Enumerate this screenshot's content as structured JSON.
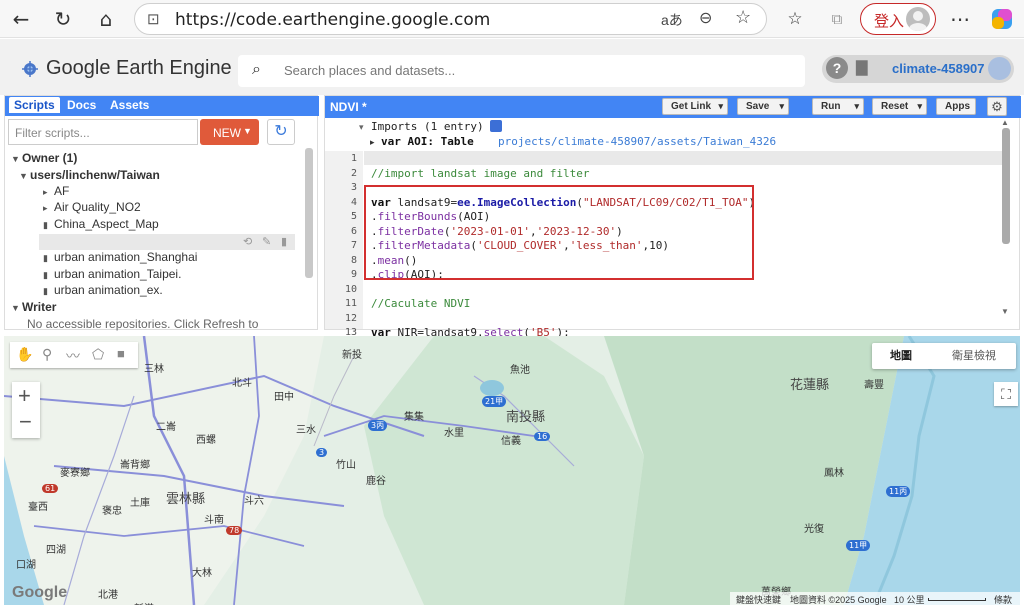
{
  "browser": {
    "url": "https://code.earthengine.google.com",
    "login_label": "登入"
  },
  "header": {
    "app_title": "Google Earth Engine",
    "search_placeholder": "Search places and datasets...",
    "project": "climate-458907"
  },
  "left_panel": {
    "tabs": [
      "Scripts",
      "Docs",
      "Assets"
    ],
    "filter_placeholder": "Filter scripts...",
    "new_label": "NEW",
    "tree": [
      {
        "label": "Owner (1)",
        "level": 0,
        "toggle": "▼",
        "bold": true
      },
      {
        "label": "users/linchenw/Taiwan",
        "level": 1,
        "toggle": "▼",
        "bold": true
      },
      {
        "label": "AF",
        "level": 2,
        "toggle": "▸",
        "bold": false
      },
      {
        "label": "Air Quality_NO2",
        "level": 2,
        "toggle": "▸",
        "bold": false
      },
      {
        "label": "China_Aspect_Map",
        "level": 2,
        "toggle": "",
        "bold": false
      },
      {
        "label": "NDVI",
        "level": 2,
        "toggle": "",
        "bold": false,
        "selected": true
      },
      {
        "label": "urban animation_Shanghai",
        "level": 2,
        "toggle": "",
        "bold": false
      },
      {
        "label": "urban animation_Taipei.",
        "level": 2,
        "toggle": "",
        "bold": false
      },
      {
        "label": "urban animation_ex.",
        "level": 2,
        "toggle": "",
        "bold": false
      },
      {
        "label": "Writer",
        "level": 0,
        "toggle": "▼",
        "bold": true
      }
    ],
    "writer_note": "No accessible repositories. Click Refresh to"
  },
  "editor": {
    "title": "NDVI *",
    "buttons": [
      "Get Link",
      "Save",
      "Run",
      "Reset",
      "Apps"
    ],
    "imports_line": "Imports (1 entry)",
    "import_var": "var AOI: Table",
    "import_path": "projects/climate-458907/assets/Taiwan_4326",
    "lines": [
      {
        "n": "1",
        "text": ""
      },
      {
        "n": "2",
        "text": "//import landsat image and filter"
      },
      {
        "n": "3",
        "text": ""
      },
      {
        "n": "4",
        "text": "var landsat9=ee.ImageCollection(\"LANDSAT/LC09/C02/T1_TOA\")"
      },
      {
        "n": "5",
        "text": ".filterBounds(AOI)"
      },
      {
        "n": "6",
        "text": ".filterDate('2023-01-01','2023-12-30')"
      },
      {
        "n": "7",
        "text": ".filterMetadata('CLOUD_COVER','less_than',10)"
      },
      {
        "n": "8",
        "text": ".mean()"
      },
      {
        "n": "9",
        "text": ".clip(AOI);"
      },
      {
        "n": "10",
        "text": ""
      },
      {
        "n": "11",
        "text": "//Caculate NDVI"
      },
      {
        "n": "12",
        "text": ""
      },
      {
        "n": "13",
        "text": "var NIR=landsat9.select('B5');"
      },
      {
        "n": "14",
        "text": "var RED=landsat9.select('B4');"
      }
    ]
  },
  "map": {
    "map_type_options": [
      "地圖",
      "衛星檢視"
    ],
    "labels": [
      "新投",
      "魚池",
      "花蓮縣",
      "壽豐",
      "北斗",
      "田中",
      "二崙",
      "西螺",
      "集集",
      "水里",
      "南投縣",
      "信義",
      "三水",
      "竹山",
      "麥寮鄉",
      "崙背鄉",
      "鹿谷",
      "雲林縣",
      "土庫",
      "斗六",
      "臺西",
      "褒忠",
      "斗南",
      "四湖",
      "大林",
      "口湖",
      "北港",
      "新港",
      "光復",
      "鳳林",
      "萬榮鄉",
      "三林"
    ],
    "road_badges": [
      "21甲",
      "3丙",
      "16",
      "3",
      "61",
      "78",
      "11甲",
      "11丙"
    ],
    "footer": [
      "鍵盤快速鍵",
      "地圖資料 ©2025 Google",
      "10 公里",
      "條款"
    ],
    "google_logo": "Google"
  }
}
